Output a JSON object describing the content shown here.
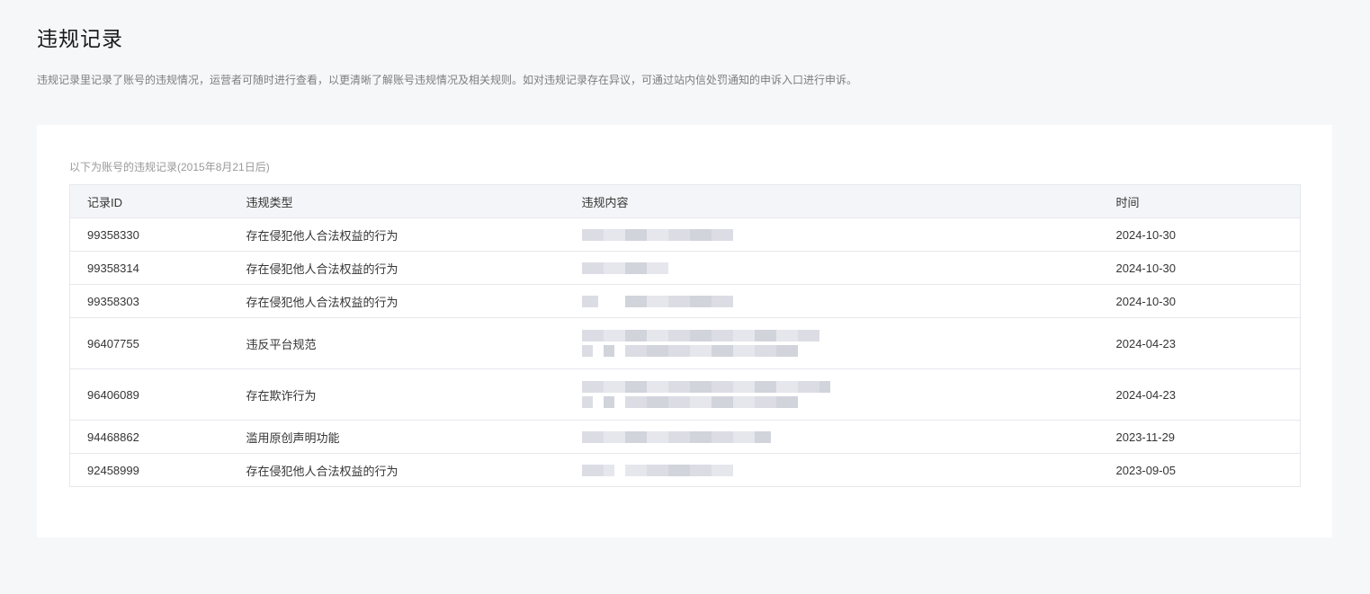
{
  "header": {
    "title": "违规记录",
    "description": "违规记录里记录了账号的违规情况，运营者可随时进行查看，以更清晰了解账号违规情况及相关规则。如对违规记录存在异议，可通过站内信处罚通知的申诉入口进行申诉。"
  },
  "records": {
    "caption": "以下为账号的违规记录(2015年8月21日后)",
    "columns": [
      "记录ID",
      "违规类型",
      "违规内容",
      "时间"
    ],
    "rows": [
      {
        "id": "99358330",
        "type": "存在侵犯他人合法权益的行为",
        "content": "redacted",
        "date": "2024-10-30"
      },
      {
        "id": "99358314",
        "type": "存在侵犯他人合法权益的行为",
        "content": "redacted",
        "date": "2024-10-30"
      },
      {
        "id": "99358303",
        "type": "存在侵犯他人合法权益的行为",
        "content": "redacted",
        "date": "2024-10-30"
      },
      {
        "id": "96407755",
        "type": "违反平台规范",
        "content": "redacted",
        "date": "2024-04-23"
      },
      {
        "id": "96406089",
        "type": "存在欺诈行为",
        "content": "redacted",
        "date": "2024-04-23"
      },
      {
        "id": "94468862",
        "type": "滥用原创声明功能",
        "content": "redacted",
        "date": "2023-11-29"
      },
      {
        "id": "92458999",
        "type": "存在侵犯他人合法权益的行为",
        "content": "redacted",
        "date": "2023-09-05"
      }
    ]
  }
}
